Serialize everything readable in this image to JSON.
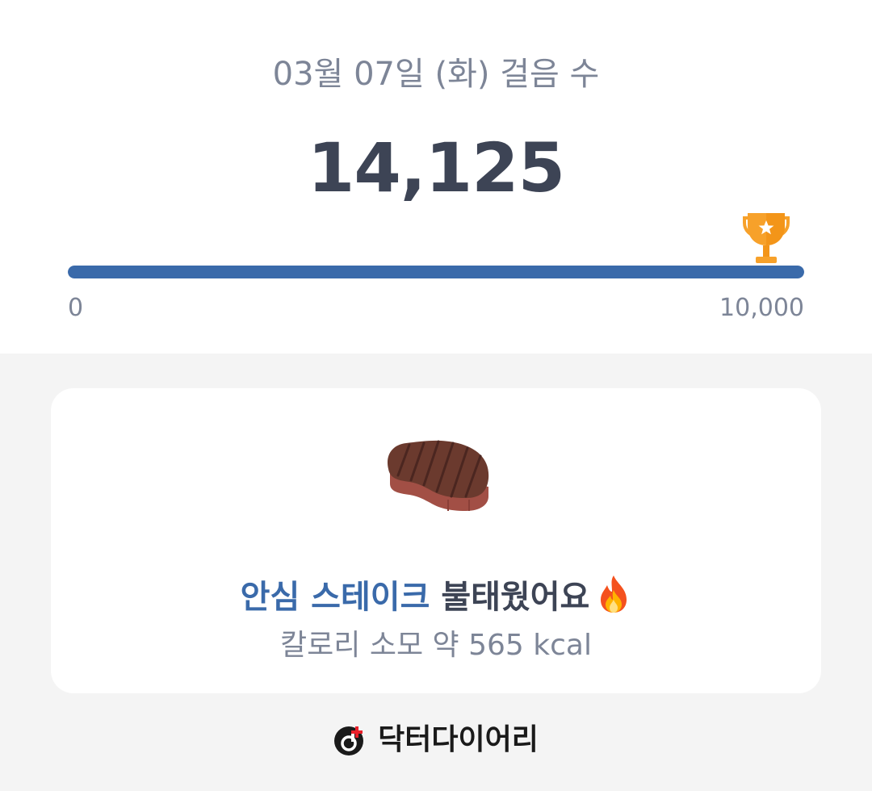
{
  "steps": {
    "date_title": "03월 07일 (화) 걸음 수",
    "count": "14,125",
    "goal_progress_fraction": 1.0,
    "scale_min": "0",
    "scale_max": "10,000",
    "goal_icon": "trophy-icon"
  },
  "burn_card": {
    "food_name": "안심 스테이크",
    "burn_suffix": " 불태웠어요",
    "food_icon": "steak-icon",
    "emoji_icon": "fire-icon",
    "calories": "칼로리 소모 약 565 kcal"
  },
  "footer": {
    "brand_name": "닥터다이어리",
    "logo_icon": "doctordiary-logo-icon"
  },
  "colors": {
    "accent_blue": "#3a6aaa",
    "text_dark": "#3d4455",
    "text_muted": "#7d8597",
    "background": "#f4f4f4",
    "trophy_gold": "#f7a12a",
    "brand_red": "#e8202a"
  }
}
